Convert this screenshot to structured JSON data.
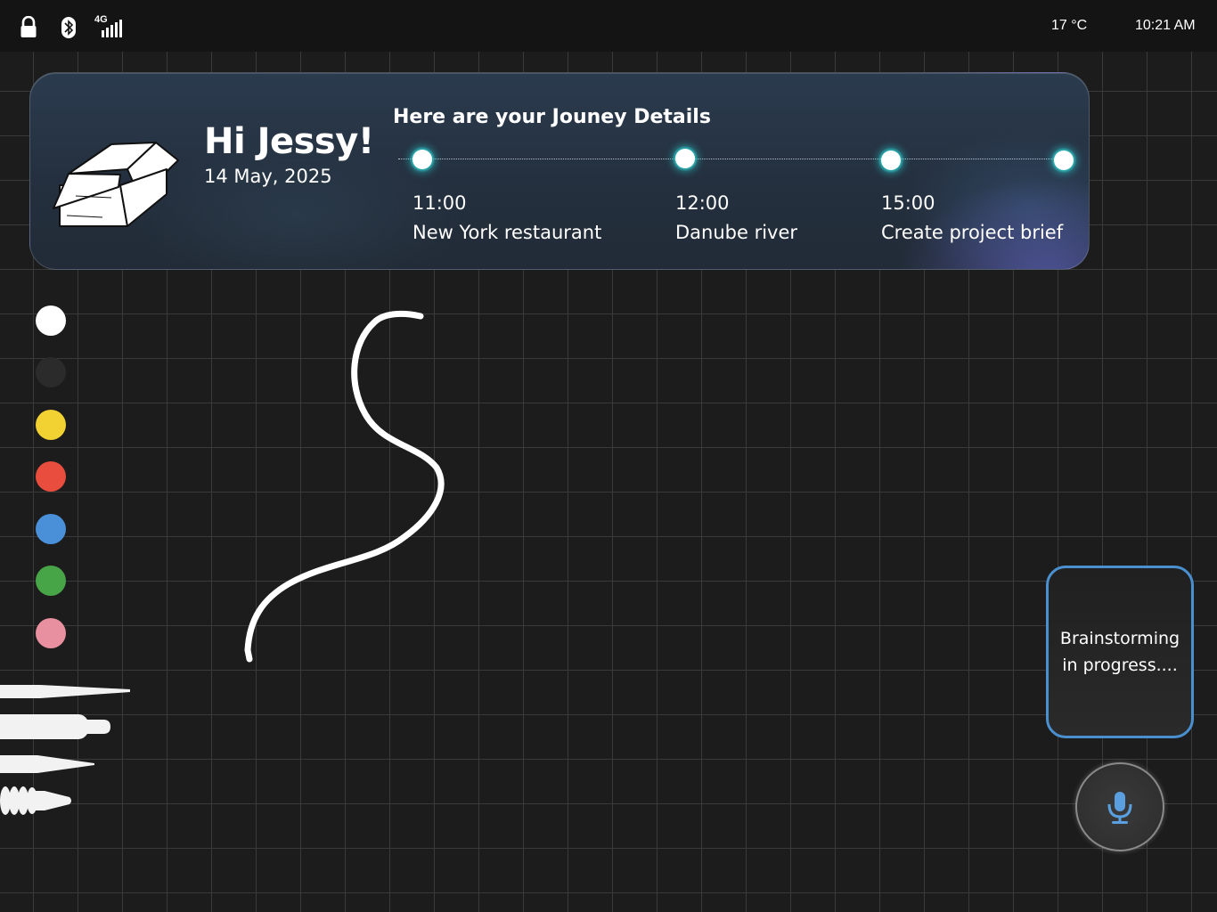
{
  "status_bar": {
    "network_label": "4G",
    "temperature": "17 °C",
    "time": "10:21 AM",
    "icons": [
      "lock-icon",
      "bluetooth-icon",
      "signal-icon"
    ]
  },
  "journey_card": {
    "greeting": "Hi Jessy!",
    "date": "14 May, 2025",
    "title": "Here are your Jouney Details",
    "events": [
      {
        "time": "11:00",
        "name": "New York restaurant"
      },
      {
        "time": "12:00",
        "name": "Danube river"
      },
      {
        "time": "15:00",
        "name": "Create project brief"
      }
    ],
    "icon": "open-box-icon"
  },
  "palette": {
    "colors": [
      "#ffffff",
      "#2b2b2b",
      "#f2d132",
      "#e84d3d",
      "#4a90d9",
      "#47a447",
      "#e8909f"
    ]
  },
  "brushes": [
    "pencil-brush",
    "marker-brush",
    "pen-brush",
    "crayon-brush"
  ],
  "brainstorm": {
    "text": "Brainstorming in progress...."
  },
  "voice": {
    "icon": "microphone-icon",
    "accent": "#5aa0e0"
  }
}
